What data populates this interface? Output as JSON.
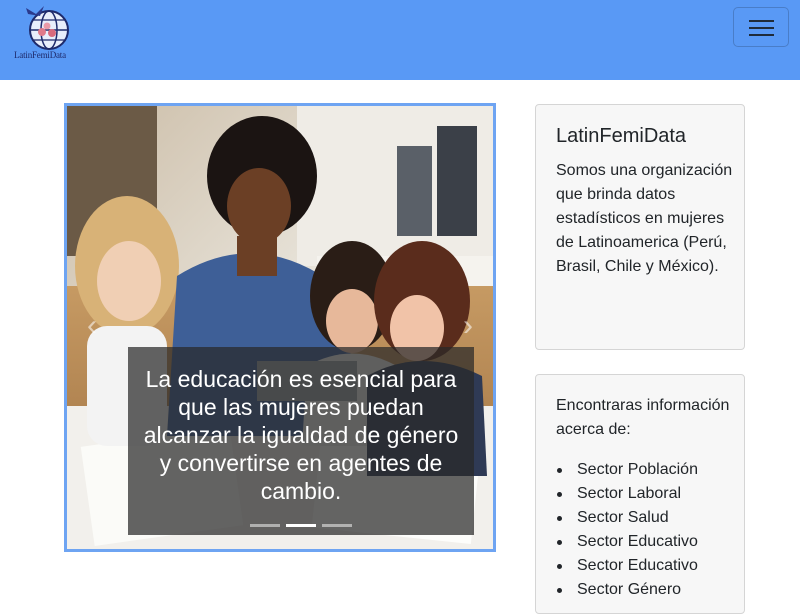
{
  "navbar": {
    "brand_text": "LatinFemiData",
    "logo_icon": "globe-women-logo",
    "toggler_icon": "hamburger-menu-icon",
    "background": "#5999f5"
  },
  "carousel": {
    "caption": "La educación es esencial para que las mujeres puedan alcanzar la igualdad de género y convertirse en agentes de cambio.",
    "indicators": {
      "count": 3,
      "active_index": 1
    },
    "border_color": "#6ea4f2"
  },
  "about_card": {
    "title": "LatinFemiData",
    "text": "Somos una organización que brinda datos estadísticos en mujeres de Latinoamerica (Perú, Brasil, Chile y México)."
  },
  "info_card": {
    "text": "Encontraras información acerca de:",
    "items": [
      "Sector Población",
      "Sector Laboral",
      "Sector Salud",
      "Sector Educativo",
      "Sector Educativo",
      "Sector Género"
    ]
  }
}
